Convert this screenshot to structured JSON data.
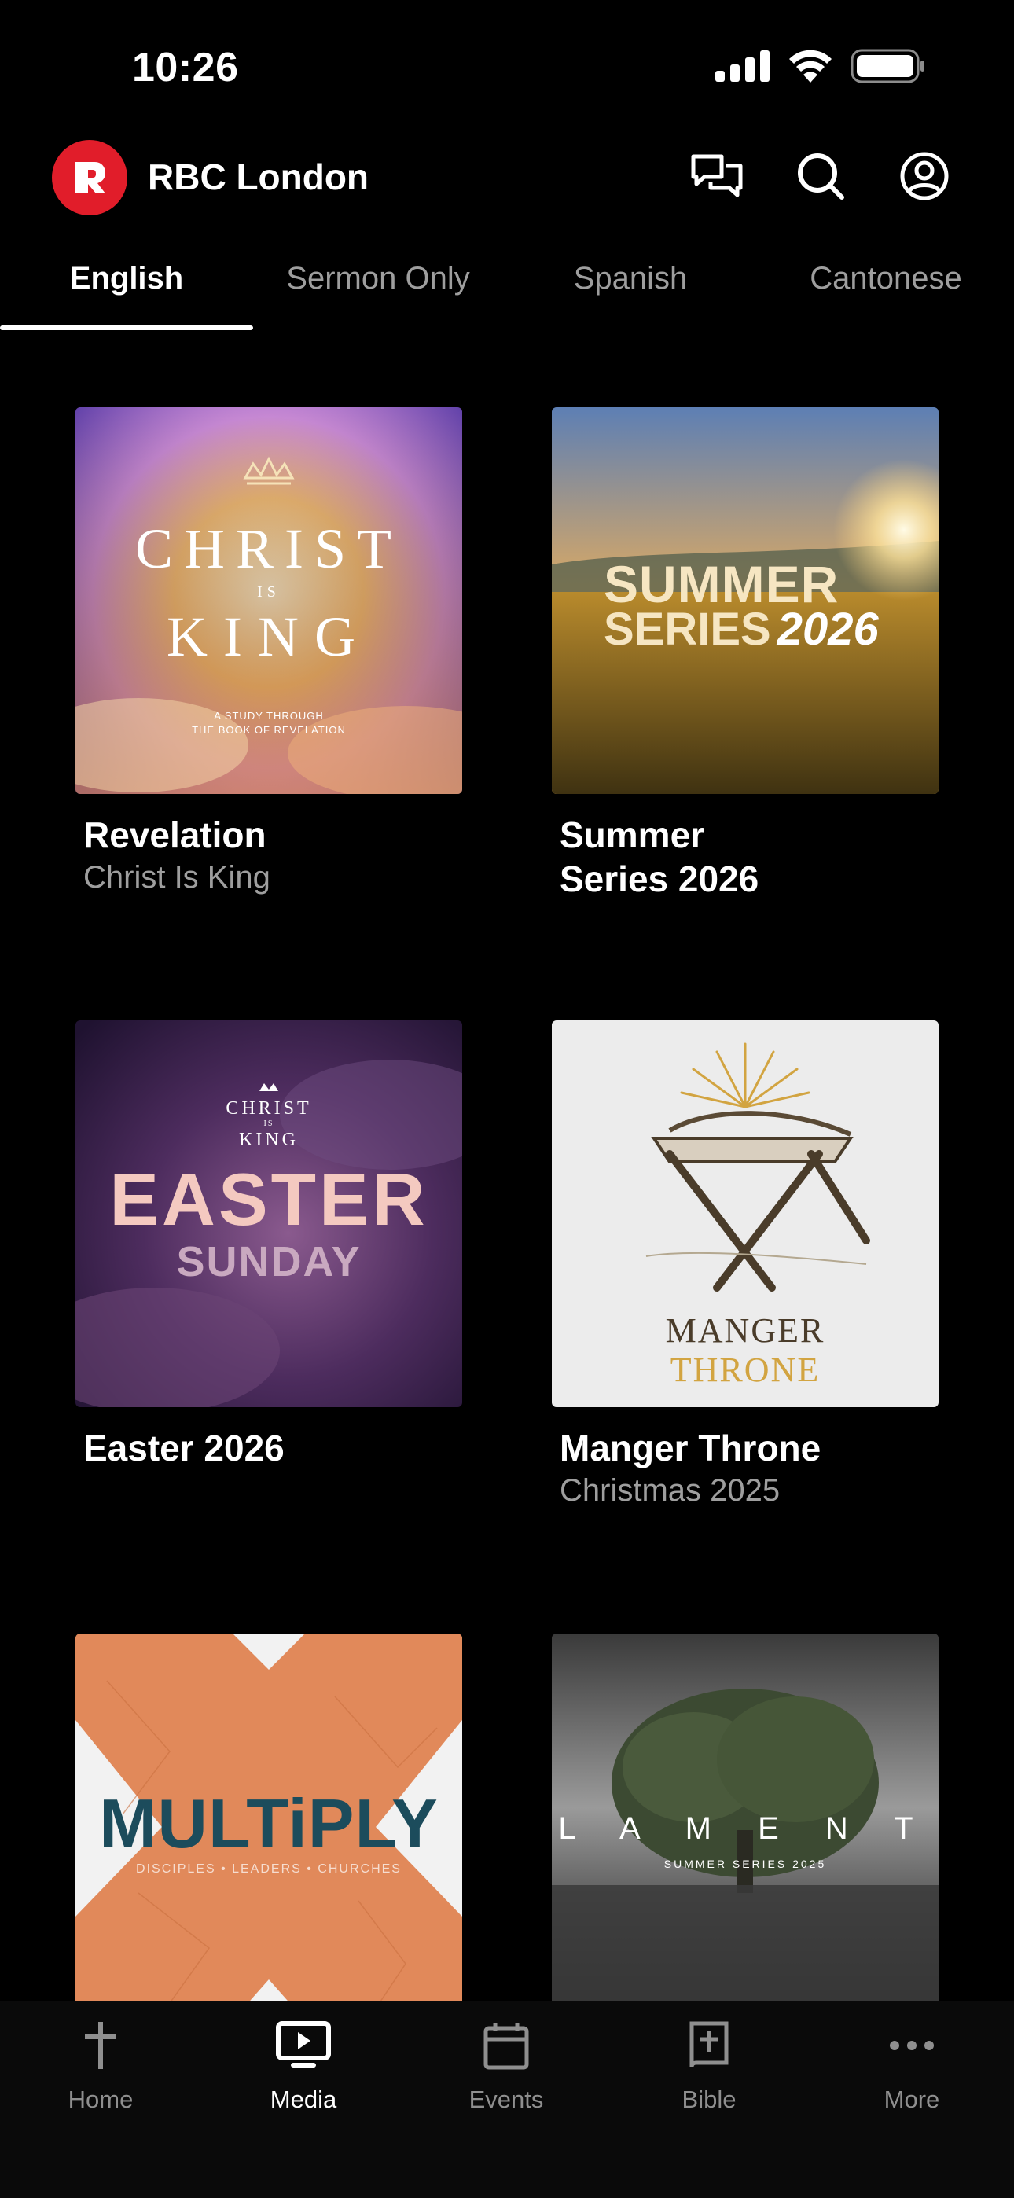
{
  "status_bar": {
    "time": "10:26",
    "icons": [
      "cellular-signal-icon",
      "wifi-icon",
      "battery-icon"
    ]
  },
  "header": {
    "logo_icon": "rbc-logo-icon",
    "title": "RBC London",
    "actions": [
      "chat-icon",
      "search-icon",
      "profile-icon"
    ]
  },
  "tabs": [
    {
      "label": "English",
      "active": true
    },
    {
      "label": "Sermon Only",
      "active": false
    },
    {
      "label": "Spanish",
      "active": false
    },
    {
      "label": "Cantonese",
      "active": false
    }
  ],
  "series": [
    {
      "title": "Revelation",
      "subtitle": "Christ Is King",
      "art": {
        "line1": "CHRIST",
        "line2": "IS",
        "line3": "KING",
        "tagline1": "A STUDY THROUGH",
        "tagline2": "THE BOOK OF REVELATION"
      }
    },
    {
      "title": "Summer Series 2026",
      "subtitle": "",
      "art": {
        "line1": "SUMMER",
        "line2": "SERIES",
        "line3": "2026"
      }
    },
    {
      "title": "Easter 2026",
      "subtitle": "",
      "art": {
        "line1": "CHRIST",
        "line2": "IS",
        "line3": "KING",
        "word1": "EASTER",
        "word2": "SUNDAY"
      }
    },
    {
      "title": "Manger Throne",
      "subtitle": "Christmas 2025",
      "art": {
        "line1": "MANGER",
        "line2": "THRONE"
      }
    },
    {
      "title": "",
      "subtitle": "",
      "art": {
        "line1": "MULTiPLY",
        "line2": "DISCIPLES • LEADERS • CHURCHES"
      }
    },
    {
      "title": "",
      "subtitle": "",
      "art": {
        "line1": "L A M E N T",
        "line2": "SUMMER SERIES 2025"
      }
    }
  ],
  "bottom_nav": [
    {
      "label": "Home",
      "icon": "cross-icon",
      "active": false
    },
    {
      "label": "Media",
      "icon": "media-play-icon",
      "active": true
    },
    {
      "label": "Events",
      "icon": "calendar-icon",
      "active": false
    },
    {
      "label": "Bible",
      "icon": "bible-icon",
      "active": false
    },
    {
      "label": "More",
      "icon": "more-dots-icon",
      "active": false
    }
  ],
  "colors": {
    "background": "#000000",
    "brand_red": "#e11d2a",
    "inactive_text": "#9e9e9e"
  }
}
